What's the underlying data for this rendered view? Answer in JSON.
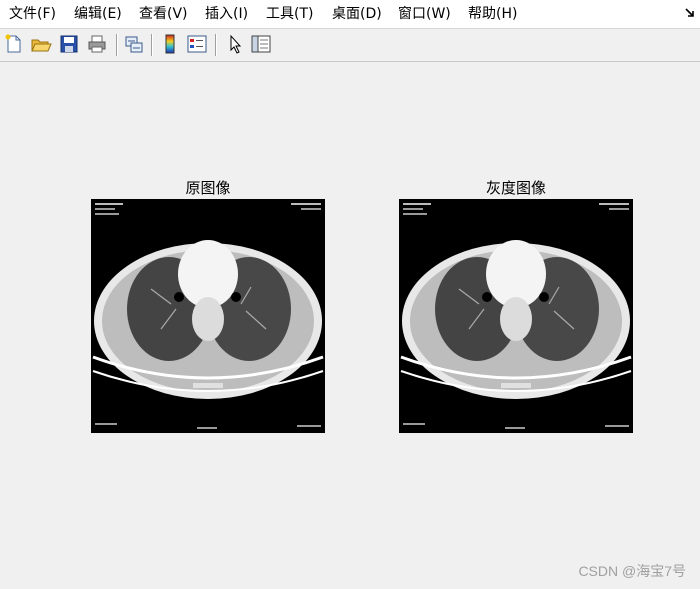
{
  "menubar": {
    "items": [
      {
        "label": "文件(F)"
      },
      {
        "label": "编辑(E)"
      },
      {
        "label": "查看(V)"
      },
      {
        "label": "插入(I)"
      },
      {
        "label": "工具(T)"
      },
      {
        "label": "桌面(D)"
      },
      {
        "label": "窗口(W)"
      },
      {
        "label": "帮助(H)"
      }
    ]
  },
  "toolbar": {
    "buttons": [
      {
        "icon": "new-figure-icon"
      },
      {
        "icon": "open-file-icon"
      },
      {
        "icon": "save-icon"
      },
      {
        "icon": "print-icon"
      },
      {
        "icon": "link-plot-icon"
      },
      {
        "icon": "insert-colorbar-icon"
      },
      {
        "icon": "insert-legend-icon"
      },
      {
        "icon": "edit-plot-arrow-icon"
      },
      {
        "icon": "property-inspector-icon"
      }
    ]
  },
  "axes": [
    {
      "title": "原图像"
    },
    {
      "title": "灰度图像"
    }
  ],
  "watermark": "CSDN @海宝7号",
  "colors": {
    "window_bg": "#f0f0f0",
    "menubar_bg": "#ffffff",
    "image_bg": "#000000"
  }
}
